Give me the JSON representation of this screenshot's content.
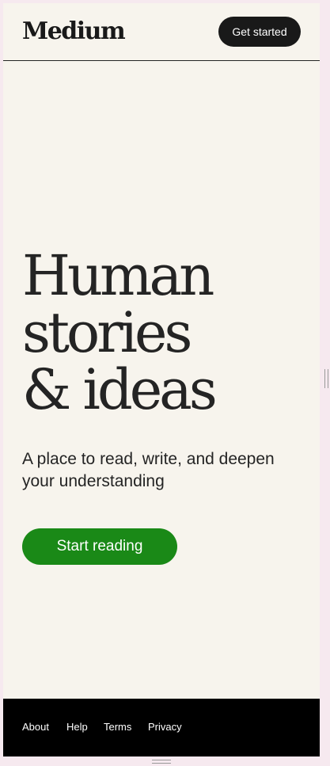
{
  "header": {
    "logo_text": "Medium",
    "get_started_label": "Get started"
  },
  "hero": {
    "title_lines": [
      "Human",
      "stories",
      "& ideas"
    ],
    "subtitle": "A place to read, write, and deepen your understanding",
    "cta_label": "Start reading"
  },
  "footer": {
    "links": [
      "About",
      "Help",
      "Terms",
      "Privacy"
    ]
  },
  "colors": {
    "background": "#f7f4ed",
    "text": "#242424",
    "cta_green": "#1a8917",
    "dark_button": "#191919",
    "footer_bg": "#000000"
  }
}
